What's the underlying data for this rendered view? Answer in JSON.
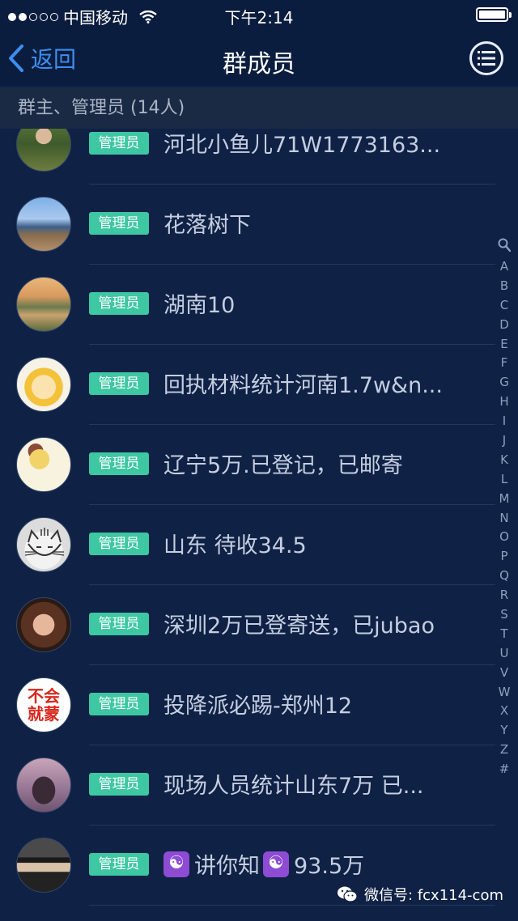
{
  "status_bar": {
    "carrier": "中国移动",
    "time": "下午2:14",
    "signal_level": "2 of 5"
  },
  "nav": {
    "back_label": "返回",
    "title": "群成员",
    "menu_icon": "list-icon"
  },
  "section": {
    "header": "群主、管理员 (14人)"
  },
  "members": [
    {
      "badge": "管理员",
      "name": "河北小鱼儿71W1773163..."
    },
    {
      "badge": "管理员",
      "name": "花落树下"
    },
    {
      "badge": "管理员",
      "name": "湖南10"
    },
    {
      "badge": "管理员",
      "name": "回执材料统计河南1.7w&n..."
    },
    {
      "badge": "管理员",
      "name": "辽宁5万.已登记，已邮寄"
    },
    {
      "badge": "管理员",
      "name": "山东 待收34.5"
    },
    {
      "badge": "管理员",
      "name": "深圳2万已登寄送，已jubao"
    },
    {
      "badge": "管理员",
      "name": "投降派必踢-郑州12"
    },
    {
      "badge": "管理员",
      "name": "现场人员统计山东7万  已..."
    },
    {
      "badge": "管理员",
      "name_part1": "讲你知",
      "name_part2": "93.5万"
    }
  ],
  "avatar_4": {
    "text_line1": "不会",
    "text_line2": "就蒙"
  },
  "index": [
    "A",
    "B",
    "C",
    "D",
    "E",
    "F",
    "G",
    "H",
    "I",
    "J",
    "K",
    "L",
    "M",
    "N",
    "O",
    "P",
    "Q",
    "R",
    "S",
    "T",
    "U",
    "V",
    "W",
    "X",
    "Y",
    "Z",
    "#"
  ],
  "watermark": {
    "text": "微信号: fcx114-com"
  },
  "colors": {
    "background": "#0f2145",
    "nav": "#0b1d3e",
    "accent_blue": "#3d8ef0",
    "badge_green": "#3dc7a2",
    "section_bg": "#1b2a44"
  }
}
